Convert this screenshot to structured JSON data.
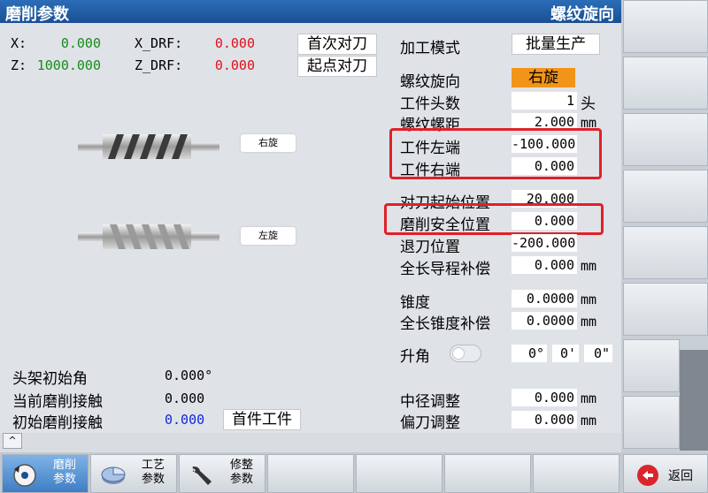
{
  "header": {
    "title": "磨削参数",
    "mode": "螺纹旋向"
  },
  "coords": {
    "x_label": "X:",
    "x_value": "0.000",
    "z_label": "Z:",
    "z_value": "1000.000",
    "xdrf_label": "X_DRF:",
    "xdrf_value": "0.000",
    "zdrf_label": "Z_DRF:",
    "zdrf_value": "0.000",
    "first_tool_set": "首次对刀",
    "start_tool_set": "起点对刀"
  },
  "screws": {
    "right_label": "右旋",
    "left_label": "左旋"
  },
  "params": {
    "process_mode": {
      "label": "加工模式",
      "value": "批量生产"
    },
    "thread_dir": {
      "label": "螺纹旋向",
      "value": "右旋"
    },
    "workpiece_heads": {
      "label": "工件头数",
      "value": "1",
      "unit": "头"
    },
    "thread_pitch": {
      "label": "螺纹螺距",
      "value": "2.000",
      "unit": "mm"
    },
    "workpiece_left": {
      "label": "工件左端",
      "value": "-100.000"
    },
    "workpiece_right": {
      "label": "工件右端",
      "value": "0.000"
    },
    "tool_set_start": {
      "label": "对刀起始位置",
      "value": "20.000"
    },
    "grind_safe": {
      "label": "磨削安全位置",
      "value": "0.000"
    },
    "retract": {
      "label": "退刀位置",
      "value": "-200.000"
    },
    "lead_comp": {
      "label": "全长导程补偿",
      "value": "0.000",
      "unit": "mm"
    },
    "taper": {
      "label": "锥度",
      "value": "0.0000",
      "unit": "mm"
    },
    "taper_comp": {
      "label": "全长锥度补偿",
      "value": "0.0000",
      "unit": "mm"
    },
    "lift_angle": {
      "label": "升角",
      "deg": "0°",
      "min": "0'",
      "sec": "0\""
    },
    "pitch_dia_adj": {
      "label": "中径调整",
      "value": "0.000",
      "unit": "mm"
    },
    "offset_adj": {
      "label": "偏刀调整",
      "value": "0.000",
      "unit": "mm"
    }
  },
  "bottom_left": {
    "head_init_angle": {
      "label": "头架初始角",
      "value": "0.000°"
    },
    "current_contact": {
      "label": "当前磨削接触",
      "value": "0.000"
    },
    "initial_contact": {
      "label": "初始磨削接触",
      "value": "0.000"
    },
    "first_piece": "首件工件"
  },
  "softkeys": {
    "up_arrow": "^",
    "grind_params": {
      "line1": "磨削",
      "line2": "参数"
    },
    "process_params": {
      "line1": "工艺",
      "line2": "参数"
    },
    "dress_params": {
      "line1": "修整",
      "line2": "参数"
    },
    "back": "返回"
  }
}
